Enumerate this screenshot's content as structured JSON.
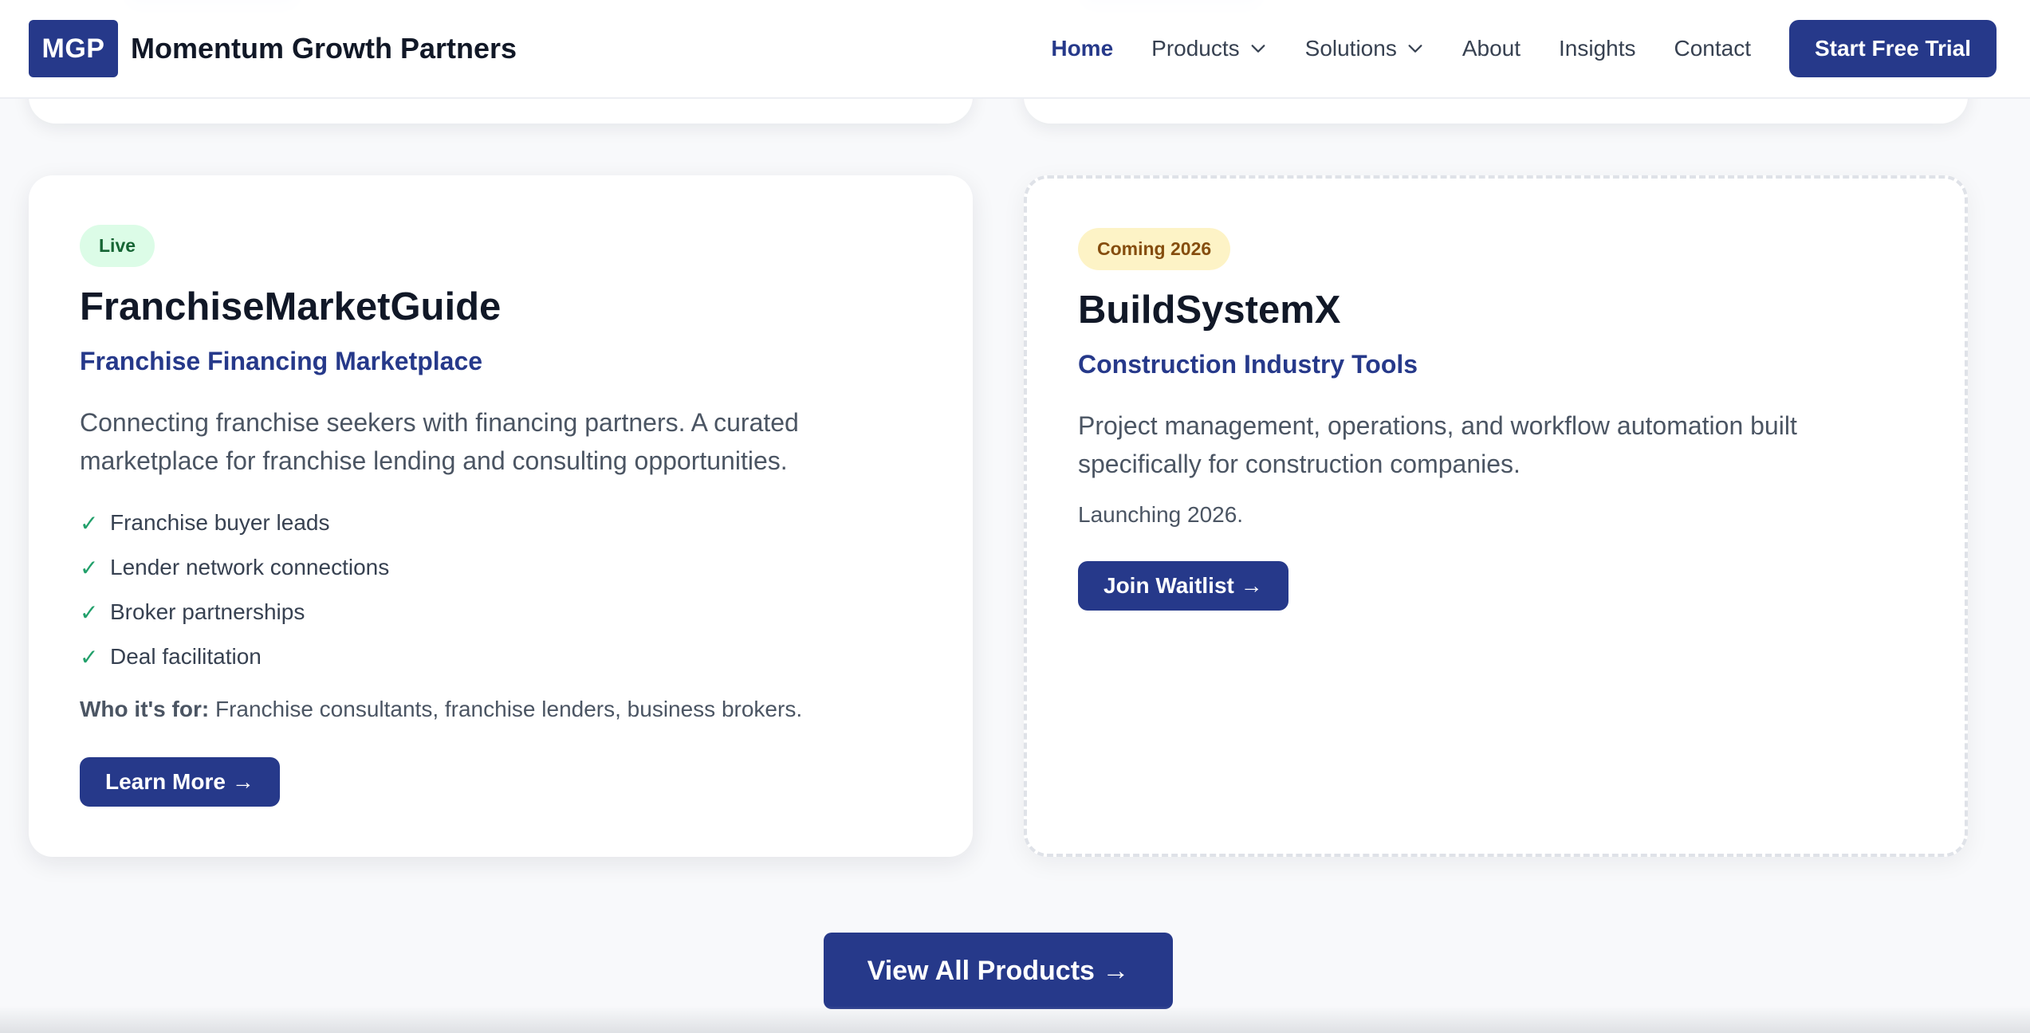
{
  "header": {
    "logo_text": "MGP",
    "brand_name": "Momentum Growth Partners",
    "nav": [
      {
        "label": "Home",
        "active": true
      },
      {
        "label": "Products",
        "dropdown": true
      },
      {
        "label": "Solutions",
        "dropdown": true
      },
      {
        "label": "About"
      },
      {
        "label": "Insights"
      },
      {
        "label": "Contact"
      }
    ],
    "cta_label": "Start Free Trial"
  },
  "cards": [
    {
      "badge": "Live",
      "title": "FranchiseMarketGuide",
      "subtitle": "Franchise Financing Marketplace",
      "description": "Connecting franchise seekers with financing partners. A curated marketplace for franchise lending and consulting opportunities.",
      "features": [
        "Franchise buyer leads",
        "Lender network connections",
        "Broker partnerships",
        "Deal facilitation"
      ],
      "check_glyph": "✓",
      "who_label": "Who it's for:",
      "who_text": " Franchise consultants, franchise lenders, business brokers.",
      "button_label": "Learn More →"
    },
    {
      "badge": "Coming 2026",
      "title": "BuildSystemX",
      "subtitle": "Construction Industry Tools",
      "description": "Project management, operations, and workflow automation built specifically for construction companies.",
      "launch_note": "Launching 2026.",
      "button_label": "Join Waitlist →"
    }
  ],
  "view_all_label": "View All Products →",
  "colors": {
    "brand": "#26398a",
    "live_badge_bg": "#dcfce7",
    "soon_badge_bg": "#fdf3c6",
    "check": "#22a06b"
  },
  "icons": {
    "dropdown": "chevron-down-icon",
    "feature": "check-icon"
  }
}
